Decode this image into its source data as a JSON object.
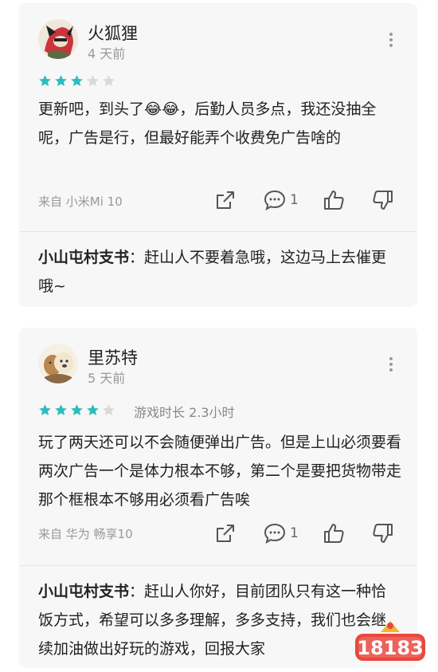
{
  "reviews": [
    {
      "username": "火狐狸",
      "date": "4 天前",
      "rating": 3,
      "playtime": "",
      "text": "更新吧，到头了😂😂，后勤人员多点，我还没抽全呢，广告是行，但最好能弄个收费免广告啥的",
      "device": "来自 小米Mi 10",
      "comment_count": "1",
      "reply": {
        "author": "小山屯村支书",
        "separator": "：",
        "text": "赶山人不要着急哦，这边马上去催更哦~"
      }
    },
    {
      "username": "里苏特",
      "date": "5 天前",
      "rating": 4,
      "playtime": "游戏时长 2.3小时",
      "text": "玩了两天还可以不会随便弹出广告。但是上山必须要看两次广告一个是体力根本不够，第二个是要把货物带走那个框根本不够用必须看广告唉",
      "device": "来自 华为 畅享10",
      "comment_count": "1",
      "reply": {
        "author": "小山屯村支书",
        "separator": "：",
        "text": "赶山人你好，目前团队只有这一种恰饭方式，希望可以多多理解，多多支持，我们也会继续加油做出好玩的游戏，回报大家"
      }
    }
  ],
  "colors": {
    "star_filled": "#2bbdbd",
    "star_empty": "#d9d9d9",
    "card_bg": "#f7f7f7",
    "watermark": "#e8483f"
  },
  "watermark": {
    "text": "18183"
  },
  "icons": [
    "share-icon",
    "comment-icon",
    "thumb-up-icon",
    "thumb-down-icon",
    "more-vertical-icon",
    "star-icon"
  ]
}
